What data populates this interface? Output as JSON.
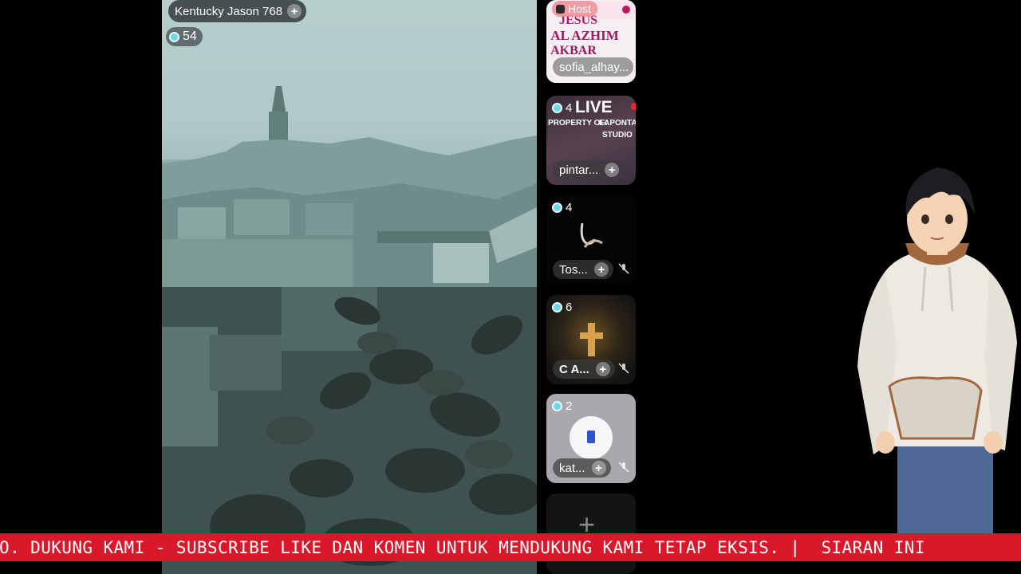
{
  "host": {
    "name": "Kentucky Jason 768",
    "viewers": "54",
    "follow_icon": "plus-icon"
  },
  "tiles": [
    {
      "name": "sofia_alhay...",
      "role": "Host",
      "poster_text": [
        "JESUS",
        "AL AZHIM",
        "AKBAR"
      ]
    },
    {
      "name": "pintar...",
      "viewers": "4",
      "live_label": "LIVE",
      "watermark": [
        "PROPERTY OF:",
        "LAPONTA",
        "STUDIO"
      ]
    },
    {
      "name": "Tos...",
      "viewers": "4"
    },
    {
      "name": "C A...",
      "viewers": "6"
    },
    {
      "name": "kat...",
      "viewers": "2"
    }
  ],
  "add_tile": {
    "icon": "plus-icon"
  },
  "ticker": {
    "text": "EO. DUKUNG KAMI - SUBSCRIBE LIKE DAN KOMEN UNTUK MENDUKUNG KAMI TETAP EKSIS. |  SIARAN INI"
  },
  "colors": {
    "ticker_bg": "#d9182a",
    "viewer_eye": "#6fd6ee",
    "live_dot": "#ff1e3c"
  }
}
